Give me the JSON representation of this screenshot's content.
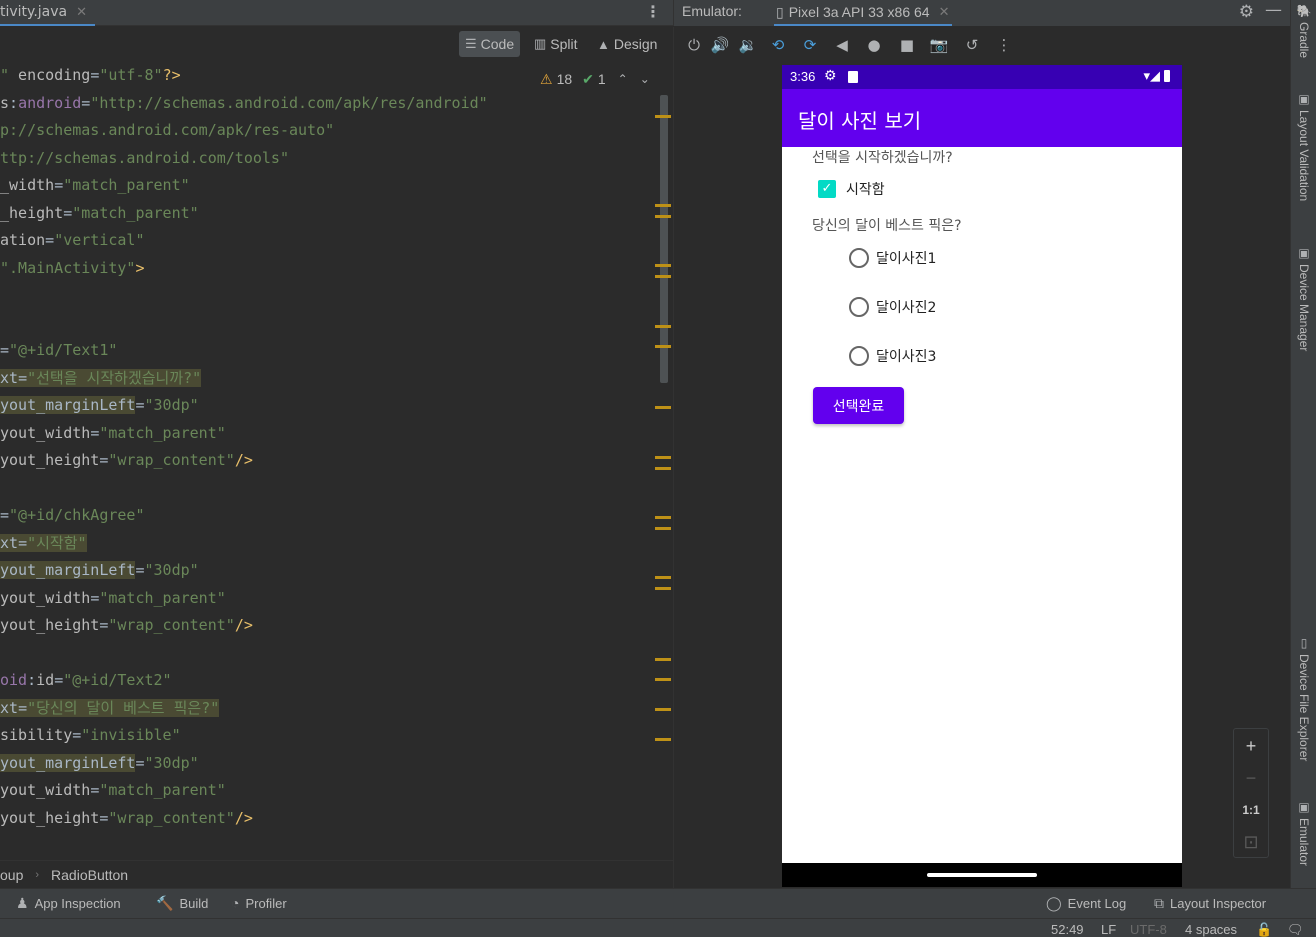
{
  "editor": {
    "tab_label": "tivity.java",
    "tab_close": "✕",
    "more_icon": "⋮",
    "modes": {
      "code": "Code",
      "split": "Split",
      "design": "Design"
    },
    "mode_icons": {
      "code": "☰",
      "split": "▥",
      "design": "▲"
    },
    "warnings_count": "18",
    "ok_count": "1",
    "warn_glyph": "⚠",
    "ok_glyph": "✔",
    "nav_up": "⌃",
    "nav_down": "⌄",
    "breadcrumb": [
      "oup",
      "RadioButton"
    ],
    "lines": [
      [
        {
          "c": "str",
          "t": "\""
        },
        {
          "c": "attr",
          "t": " encoding"
        },
        {
          "c": "eq",
          "t": "="
        },
        {
          "c": "str",
          "t": "\"utf-8\""
        },
        {
          "c": "punct",
          "t": "?>"
        }
      ],
      [
        {
          "c": "attr",
          "t": "s"
        },
        {
          "c": "eq",
          "t": ":"
        },
        {
          "c": "ns",
          "t": "android"
        },
        {
          "c": "eq",
          "t": "="
        },
        {
          "c": "str",
          "t": "\"http://schemas.android.com/apk/res/android\""
        }
      ],
      [
        {
          "c": "str",
          "t": "p://schemas.android.com/apk/res-auto\""
        }
      ],
      [
        {
          "c": "str",
          "t": "ttp://schemas.android.com/tools\""
        }
      ],
      [
        {
          "c": "attr",
          "t": "_width"
        },
        {
          "c": "eq",
          "t": "="
        },
        {
          "c": "str",
          "t": "\"match_parent\""
        }
      ],
      [
        {
          "c": "attr",
          "t": "_height"
        },
        {
          "c": "eq",
          "t": "="
        },
        {
          "c": "str",
          "t": "\"match_parent\""
        }
      ],
      [
        {
          "c": "attr",
          "t": "ation"
        },
        {
          "c": "eq",
          "t": "="
        },
        {
          "c": "str",
          "t": "\"vertical\""
        }
      ],
      [
        {
          "c": "str",
          "t": "\".MainActivity\""
        },
        {
          "c": "punct",
          "t": ">"
        }
      ],
      [],
      [],
      [
        {
          "c": "eq",
          "t": "="
        },
        {
          "c": "str",
          "t": "\"@+id/Text1\""
        }
      ],
      [
        {
          "c": "hl",
          "t": "xt"
        },
        {
          "c": "hl",
          "t": "="
        },
        {
          "c": "hl-str",
          "t": "\"선택을 시작하겠습니까?\""
        }
      ],
      [
        {
          "c": "hl",
          "t": "yout_marginLeft"
        },
        {
          "c": "eq",
          "t": "="
        },
        {
          "c": "str",
          "t": "\"30dp\""
        }
      ],
      [
        {
          "c": "attr",
          "t": "yout_width"
        },
        {
          "c": "eq",
          "t": "="
        },
        {
          "c": "str",
          "t": "\"match_parent\""
        }
      ],
      [
        {
          "c": "attr",
          "t": "yout_height"
        },
        {
          "c": "eq",
          "t": "="
        },
        {
          "c": "str",
          "t": "\"wrap_content\""
        },
        {
          "c": "punct",
          "t": "/>"
        }
      ],
      [],
      [
        {
          "c": "eq",
          "t": "="
        },
        {
          "c": "str",
          "t": "\"@+id/chkAgree\""
        }
      ],
      [
        {
          "c": "hl",
          "t": "xt"
        },
        {
          "c": "hl",
          "t": "="
        },
        {
          "c": "hl-str",
          "t": "\"시작함\""
        }
      ],
      [
        {
          "c": "hl",
          "t": "yout_marginLeft"
        },
        {
          "c": "eq",
          "t": "="
        },
        {
          "c": "str",
          "t": "\"30dp\""
        }
      ],
      [
        {
          "c": "attr",
          "t": "yout_width"
        },
        {
          "c": "eq",
          "t": "="
        },
        {
          "c": "str",
          "t": "\"match_parent\""
        }
      ],
      [
        {
          "c": "attr",
          "t": "yout_height"
        },
        {
          "c": "eq",
          "t": "="
        },
        {
          "c": "str",
          "t": "\"wrap_content\""
        },
        {
          "c": "punct",
          "t": "/>"
        }
      ],
      [],
      [
        {
          "c": "ns",
          "t": "oid"
        },
        {
          "c": "eq",
          "t": ":"
        },
        {
          "c": "attr",
          "t": "id"
        },
        {
          "c": "eq",
          "t": "="
        },
        {
          "c": "str",
          "t": "\"@+id/Text2\""
        }
      ],
      [
        {
          "c": "hl",
          "t": "xt"
        },
        {
          "c": "hl",
          "t": "="
        },
        {
          "c": "hl-str",
          "t": "\"당신의 달이 베스트 픽은?\""
        }
      ],
      [
        {
          "c": "attr",
          "t": "sibility"
        },
        {
          "c": "eq",
          "t": "="
        },
        {
          "c": "str",
          "t": "\"invisible\""
        }
      ],
      [
        {
          "c": "hl",
          "t": "yout_marginLeft"
        },
        {
          "c": "eq",
          "t": "="
        },
        {
          "c": "str",
          "t": "\"30dp\""
        }
      ],
      [
        {
          "c": "attr",
          "t": "yout_width"
        },
        {
          "c": "eq",
          "t": "="
        },
        {
          "c": "str",
          "t": "\"match_parent\""
        }
      ],
      [
        {
          "c": "attr",
          "t": "yout_height"
        },
        {
          "c": "eq",
          "t": "="
        },
        {
          "c": "str",
          "t": "\"wrap_content\""
        },
        {
          "c": "punct",
          "t": "/>"
        }
      ]
    ]
  },
  "emulator": {
    "label": "Emulator:",
    "device_tab": "Pixel 3a API 33 x86 64",
    "tab_close": "✕",
    "settings_icon": "⚙",
    "minimize_icon": "—",
    "controls": [
      {
        "name": "power-icon",
        "glyph": "⏻"
      },
      {
        "name": "volume-up-icon",
        "glyph": "🔊"
      },
      {
        "name": "volume-down-icon",
        "glyph": "🔉"
      },
      {
        "name": "rotate-left-icon",
        "glyph": "⟲"
      },
      {
        "name": "rotate-right-icon",
        "glyph": "⟳"
      },
      {
        "name": "back-icon",
        "glyph": "◀"
      },
      {
        "name": "home-icon",
        "glyph": "●"
      },
      {
        "name": "overview-icon",
        "glyph": "■"
      },
      {
        "name": "screenshot-icon",
        "glyph": "📷"
      },
      {
        "name": "snapshot-icon",
        "glyph": "↺"
      },
      {
        "name": "more-icon",
        "glyph": "⋮"
      }
    ],
    "zoom": {
      "zoom_in": "+",
      "zoom_out": "−",
      "actual_size": "1:1",
      "fit": "⊡"
    }
  },
  "phone": {
    "status_time": "3:36",
    "status_gear": "⚙",
    "status_signal": "▾◢",
    "app_title": "달이 사진 보기",
    "question1": "선택을 시작하겠습니까?",
    "checkbox_label": "시작함",
    "checkbox_checked": true,
    "check_glyph": "✓",
    "question2": "당신의 달이 베스트 픽은?",
    "radios": [
      "달이사진1",
      "달이사진2",
      "달이사진3"
    ],
    "done_button": "선택완료",
    "colors": {
      "status_bar": "#3700b3",
      "app_bar": "#6200ee",
      "checkbox": "#03dac5",
      "button": "#6200ee"
    }
  },
  "right_strip": [
    {
      "name": "gradle",
      "label": "Gradle",
      "icon": "🐘"
    },
    {
      "name": "layout-validation",
      "label": "Layout Validation",
      "icon": "▣"
    },
    {
      "name": "device-manager",
      "label": "Device Manager",
      "icon": "▣"
    },
    {
      "name": "device-file-explorer",
      "label": "Device File Explorer",
      "icon": "▯"
    },
    {
      "name": "emulator",
      "label": "Emulator",
      "icon": "▣"
    }
  ],
  "bottom_tools": {
    "app_inspection": "App Inspection",
    "build": "Build",
    "profiler": "Profiler",
    "event_log": "Event Log",
    "layout_inspector": "Layout Inspector",
    "icons": {
      "app_inspection": "♟",
      "build": "🔨",
      "profiler": "◔",
      "event_log": "◯",
      "layout_inspector": "⧉"
    }
  },
  "status": {
    "position": "52:49",
    "line_sep": "LF",
    "encoding": "UTF-8",
    "indent": "4 spaces",
    "lock_icon": "🔓",
    "notify_icon": "🗨"
  }
}
